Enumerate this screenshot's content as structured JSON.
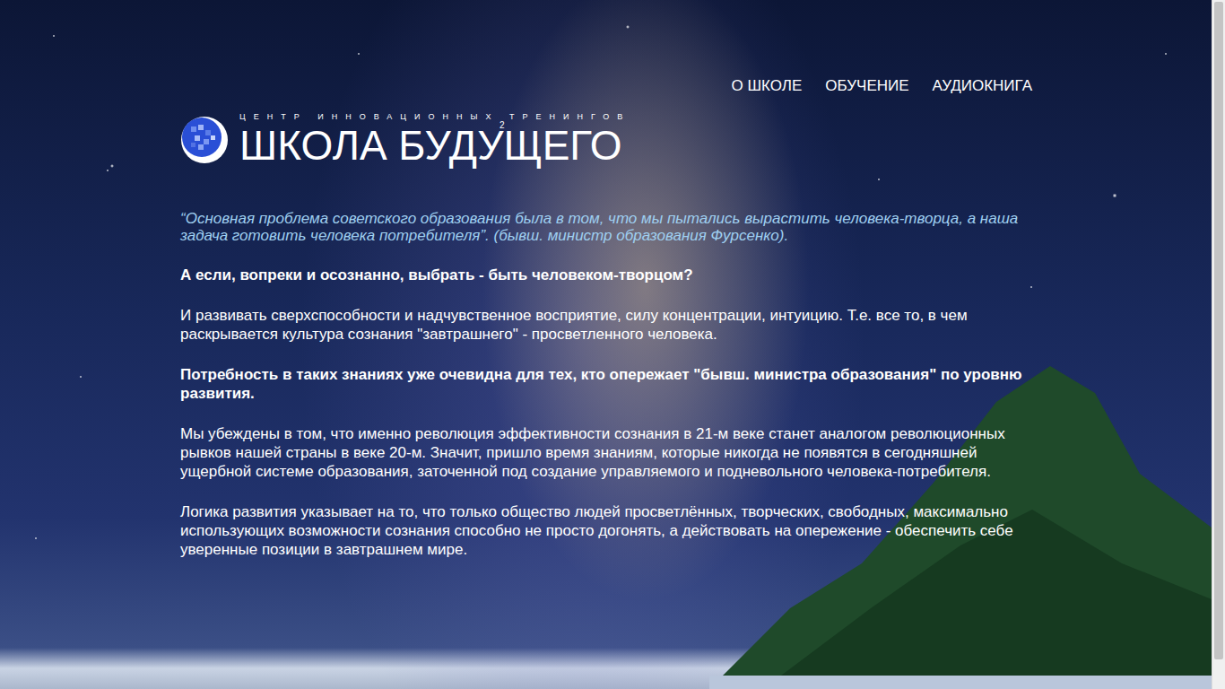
{
  "nav": [
    {
      "label": "О ШКОЛЕ"
    },
    {
      "label": "ОБУЧЕНИЕ"
    },
    {
      "label": "АУДИОКНИГА"
    }
  ],
  "logo": {
    "subtitle": "ЦЕНТР ИННОВАЦИОННЫХ ТРЕНИНГОВ",
    "title": "ШКОЛА БУДУЩЕГО",
    "mark": "2"
  },
  "quote": "“Основная проблема советского образования была в том, что мы пытались вырастить человека-творца, а наша задача готовить человека потребителя”. (бывш. министр образования Фурсенко).",
  "paragraphs": [
    {
      "kind": "lead",
      "text": "А если, вопреки и осознанно, выбрать - быть человеком-творцом?"
    },
    {
      "kind": "text",
      "text": "И развивать сверхспособности и надчувственное восприятие, силу концентрации, интуицию. Т.е. все то, в чем раскрывается культура сознания \"завтрашнего\" - просветленного человека."
    },
    {
      "kind": "lead",
      "text": "Потребность в таких знаниях уже очевидна для тех, кто опережает \"бывш. министра образования\" по уровню развития."
    },
    {
      "kind": "text",
      "text": "Мы убеждены в том, что именно революция эффективности сознания в 21-м веке станет аналогом революционных рывков нашей страны в веке 20-м. Значит, пришло время знаниям, которые никогда не появятся в сегодняшней ущербной системе образования, заточенной под создание управляемого и подневольного человека-потребителя."
    },
    {
      "kind": "text",
      "text": "Логика развития указывает на то, что только общество людей просветлённых, творческих, свободных, максимально использующих возможности сознания способно не просто догонять, а действовать на опережение - обеспечить себе уверенные позиции в завтрашнем мире."
    }
  ],
  "scrollbar": {
    "level": 0.96
  }
}
